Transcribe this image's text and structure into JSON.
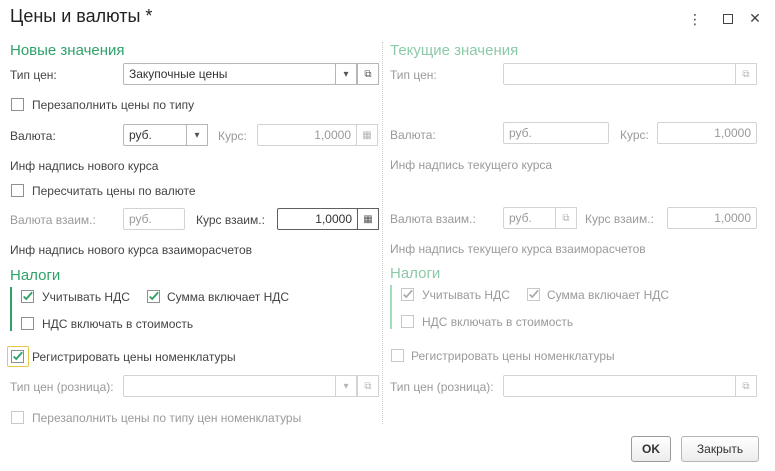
{
  "window": {
    "title": "Цены и валюты *",
    "menu_icon": "more-vertical-icon",
    "maximize_icon": "maximize-icon",
    "close_icon": "close-icon"
  },
  "left": {
    "new_values_header": "Новые значения",
    "price_type_label": "Тип цен:",
    "price_type_value": "Закупочные цены",
    "refill_by_type_label": "Перезаполнить цены по типу",
    "refill_by_type_checked": false,
    "currency_label": "Валюта:",
    "currency_value": "руб.",
    "rate_label": "Курс:",
    "rate_value": "1,0000",
    "new_rate_caption": "Инф надпись нового курса",
    "recalc_label": "Пересчитать цены по валюте",
    "recalc_checked": false,
    "settlement_currency_label": "Валюта взаим.:",
    "settlement_currency_value": "руб.",
    "settlement_rate_label": "Курс взаим.:",
    "settlement_rate_value": "1,0000",
    "new_settlement_caption": "Инф надпись нового курса взаиморасчетов",
    "taxes_header": "Налоги",
    "account_vat_label": "Учитывать НДС",
    "account_vat_checked": true,
    "sum_includes_vat_label": "Сумма включает НДС",
    "sum_includes_vat_checked": true,
    "vat_in_cost_label": "НДС включать в стоимость",
    "vat_in_cost_checked": false,
    "register_prices_label": "Регистрировать цены номенклатуры",
    "register_prices_checked": true,
    "retail_price_type_label": "Тип цен (розница):",
    "retail_price_type_value": "",
    "refill_by_nomenclature_label": "Перезаполнить цены по типу цен номенклатуры",
    "refill_by_nomenclature_checked": false
  },
  "right": {
    "current_values_header": "Текущие значения",
    "price_type_label": "Тип цен:",
    "price_type_value": "",
    "currency_label": "Валюта:",
    "currency_value": "руб.",
    "rate_label": "Курс:",
    "rate_value": "1,0000",
    "current_rate_caption": "Инф надпись текущего курса",
    "settlement_currency_label": "Валюта взаим.:",
    "settlement_currency_value": "руб.",
    "settlement_rate_label": "Курс взаим.:",
    "settlement_rate_value": "1,0000",
    "current_settlement_caption": "Инф надпись текущего курса взаиморасчетов",
    "taxes_header": "Налоги",
    "account_vat_label": "Учитывать НДС",
    "account_vat_checked": true,
    "sum_includes_vat_label": "Сумма включает НДС",
    "sum_includes_vat_checked": true,
    "vat_in_cost_label": "НДС включать в стоимость",
    "vat_in_cost_checked": false,
    "register_prices_label": "Регистрировать цены номенклатуры",
    "register_prices_checked": false,
    "retail_price_type_label": "Тип цен (розница):",
    "retail_price_type_value": ""
  },
  "footer": {
    "ok_label": "OK",
    "close_label": "Закрыть"
  },
  "colors": {
    "section_green": "#2fa26a",
    "section_green_disabled": "#8cc9a8",
    "focus_outline": "#e8c84a"
  }
}
